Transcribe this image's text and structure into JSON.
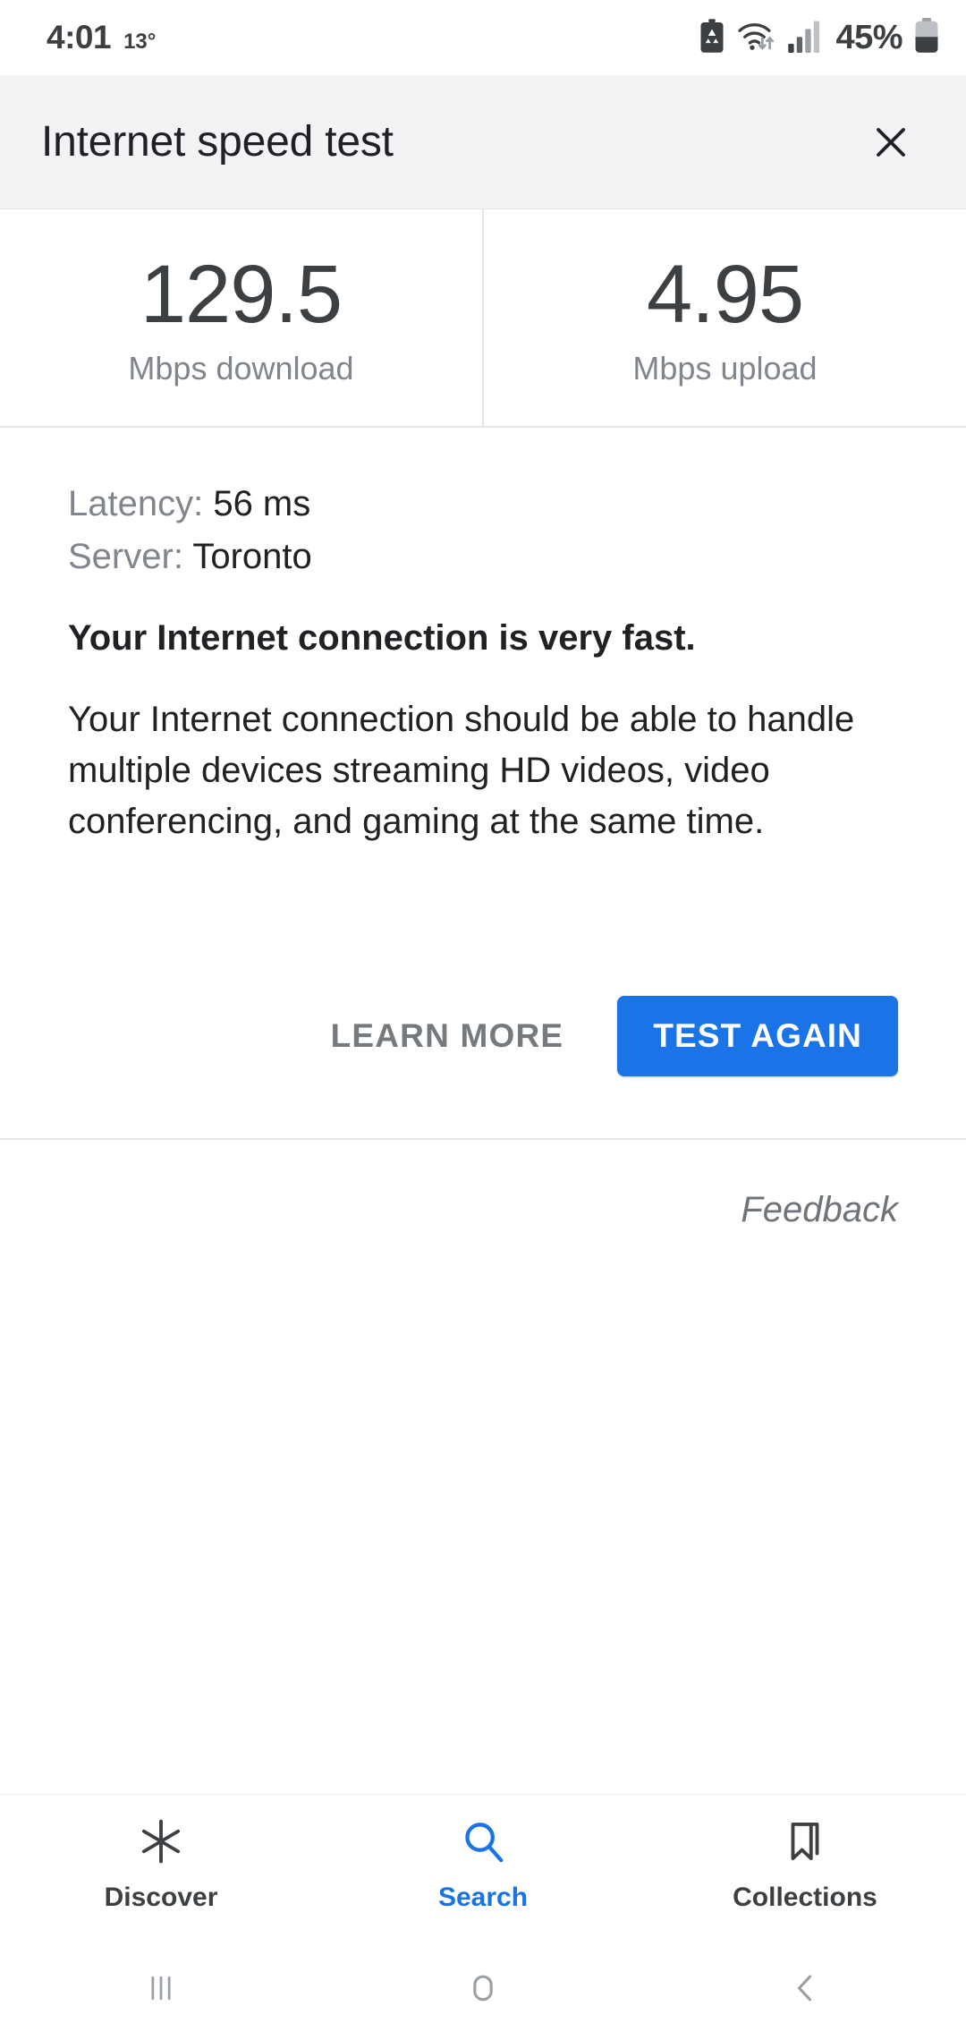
{
  "status_bar": {
    "time": "4:01",
    "temperature": "13°",
    "battery_percent": "45%",
    "icons": [
      "battery-saver-icon",
      "wifi-icon",
      "cellular-signal-icon",
      "battery-icon"
    ]
  },
  "header": {
    "title": "Internet speed test",
    "close_label": "close-icon"
  },
  "stats": [
    {
      "value": "129.5",
      "label": "Mbps download"
    },
    {
      "value": "4.95",
      "label": "Mbps upload"
    }
  ],
  "details": {
    "latency_label": "Latency: ",
    "latency_value": "56 ms",
    "server_label": "Server: ",
    "server_value": "Toronto",
    "headline": "Your Internet connection is very fast.",
    "paragraph": "Your Internet connection should be able to handle multiple devices streaming HD videos, video conferencing, and gaming at the same time."
  },
  "actions": {
    "learn_more_label": "LEARN MORE",
    "test_again_label": "TEST AGAIN",
    "accent_color": "#1b73e8"
  },
  "feedback": {
    "label": "Feedback"
  },
  "bottom_nav": {
    "items": [
      {
        "label": "Discover",
        "icon": "asterisk-icon",
        "active": false
      },
      {
        "label": "Search",
        "icon": "search-icon",
        "active": true
      },
      {
        "label": "Collections",
        "icon": "bookmark-icon",
        "active": false
      }
    ],
    "active_color": "#1b73e8"
  },
  "system_nav": {
    "recents": "recents-icon",
    "home": "home-icon",
    "back": "back-icon"
  }
}
